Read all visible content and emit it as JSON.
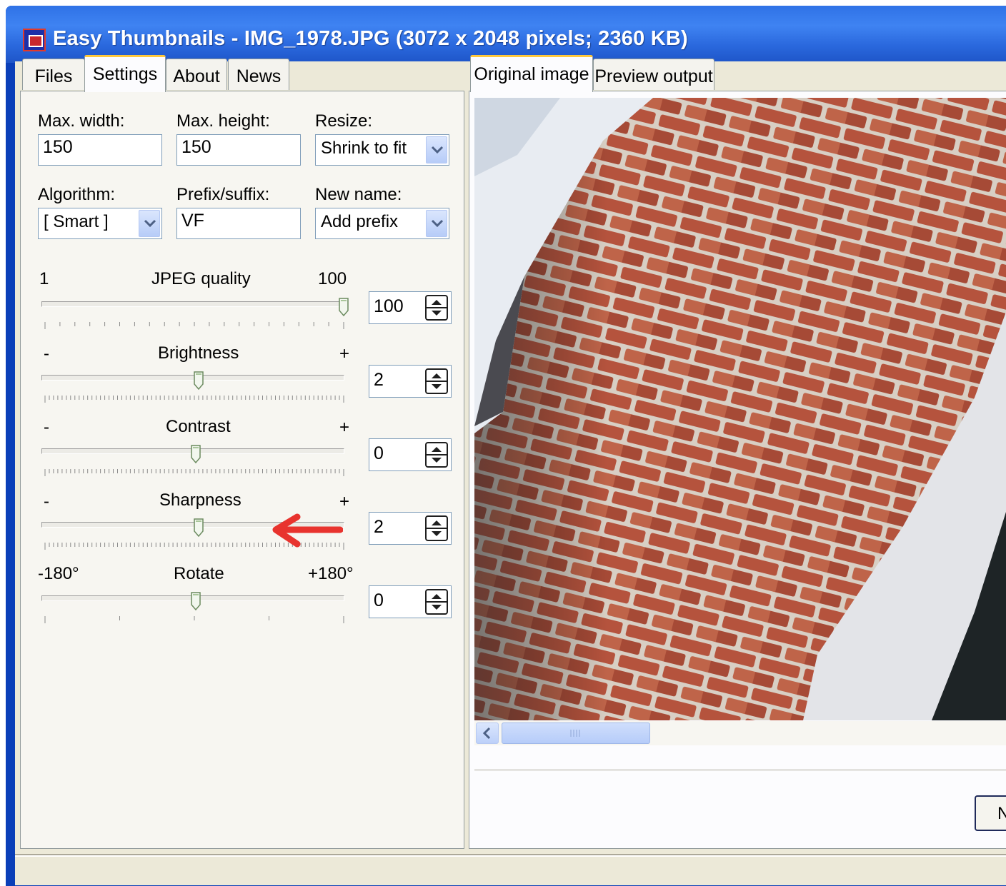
{
  "window": {
    "title": "Easy Thumbnails - IMG_1978.JPG  (3072 x 2048 pixels;  2360 KB)"
  },
  "left_tabs": [
    {
      "label": "Files",
      "active": false
    },
    {
      "label": "Settings",
      "active": true
    },
    {
      "label": "About",
      "active": false
    },
    {
      "label": "News",
      "active": false
    }
  ],
  "right_tabs": [
    {
      "label": "Original image",
      "active": true
    },
    {
      "label": "Preview output",
      "active": false
    }
  ],
  "settings": {
    "max_width": {
      "label": "Max. width:",
      "value": "150"
    },
    "max_height": {
      "label": "Max. height:",
      "value": "150"
    },
    "resize": {
      "label": "Resize:",
      "value": "Shrink to fit"
    },
    "algorithm": {
      "label": "Algorithm:",
      "value": "[ Smart ]"
    },
    "prefix_suffix": {
      "label": "Prefix/suffix:",
      "value": "VF"
    },
    "new_name": {
      "label": "New name:",
      "value": "Add prefix"
    }
  },
  "sliders": {
    "jpeg_quality": {
      "label": "JPEG quality",
      "min_label": "1",
      "max_label": "100",
      "value": "100",
      "fraction": 1.0
    },
    "brightness": {
      "label": "Brightness",
      "min_label": "-",
      "max_label": "+",
      "value": "2",
      "fraction": 0.51
    },
    "contrast": {
      "label": "Contrast",
      "min_label": "-",
      "max_label": "+",
      "value": "0",
      "fraction": 0.5
    },
    "sharpness": {
      "label": "Sharpness",
      "min_label": "-",
      "max_label": "+",
      "value": "2",
      "fraction": 0.51
    },
    "rotate": {
      "label": "Rotate",
      "min_label": "-180°",
      "max_label": "+180°",
      "value": "0",
      "fraction": 0.5
    }
  },
  "partial_button_label": "N",
  "colors": {
    "accent_arrow": "#e8332e",
    "titlebar": "#2f72e6",
    "tab_highlight": "#ffc83c"
  }
}
